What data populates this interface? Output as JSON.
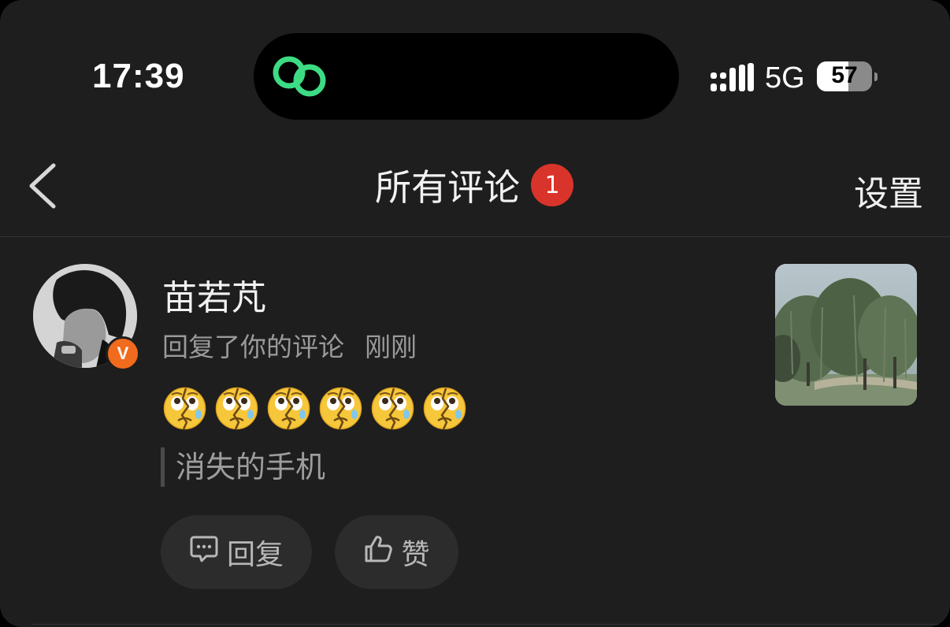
{
  "status_bar": {
    "time": "17:39",
    "network": "5G",
    "battery_percent": "57",
    "battery_level": 0.57,
    "island_icon": "link-rings-icon",
    "island_icon_color": "#3ddc84"
  },
  "nav": {
    "back_icon": "chevron-left-icon",
    "title": "所有评论",
    "badge_count": "1",
    "badge_color": "#d9342b",
    "settings_label": "设置"
  },
  "comment": {
    "username": "苗若芃",
    "verified_badge": "V",
    "verified_color": "#f16b1c",
    "action_text": "回复了你的评论",
    "timestamp": "刚刚",
    "emojis": [
      "broken-face-emoji",
      "broken-face-emoji",
      "broken-face-emoji",
      "broken-face-emoji",
      "broken-face-emoji",
      "broken-face-emoji"
    ],
    "quoted_text": "消失的手机",
    "thumbnail": "willow-trees-photo",
    "reply_label": "回复",
    "reply_icon": "comment-bubble-icon",
    "like_label": "赞",
    "like_icon": "thumbs-up-icon"
  }
}
